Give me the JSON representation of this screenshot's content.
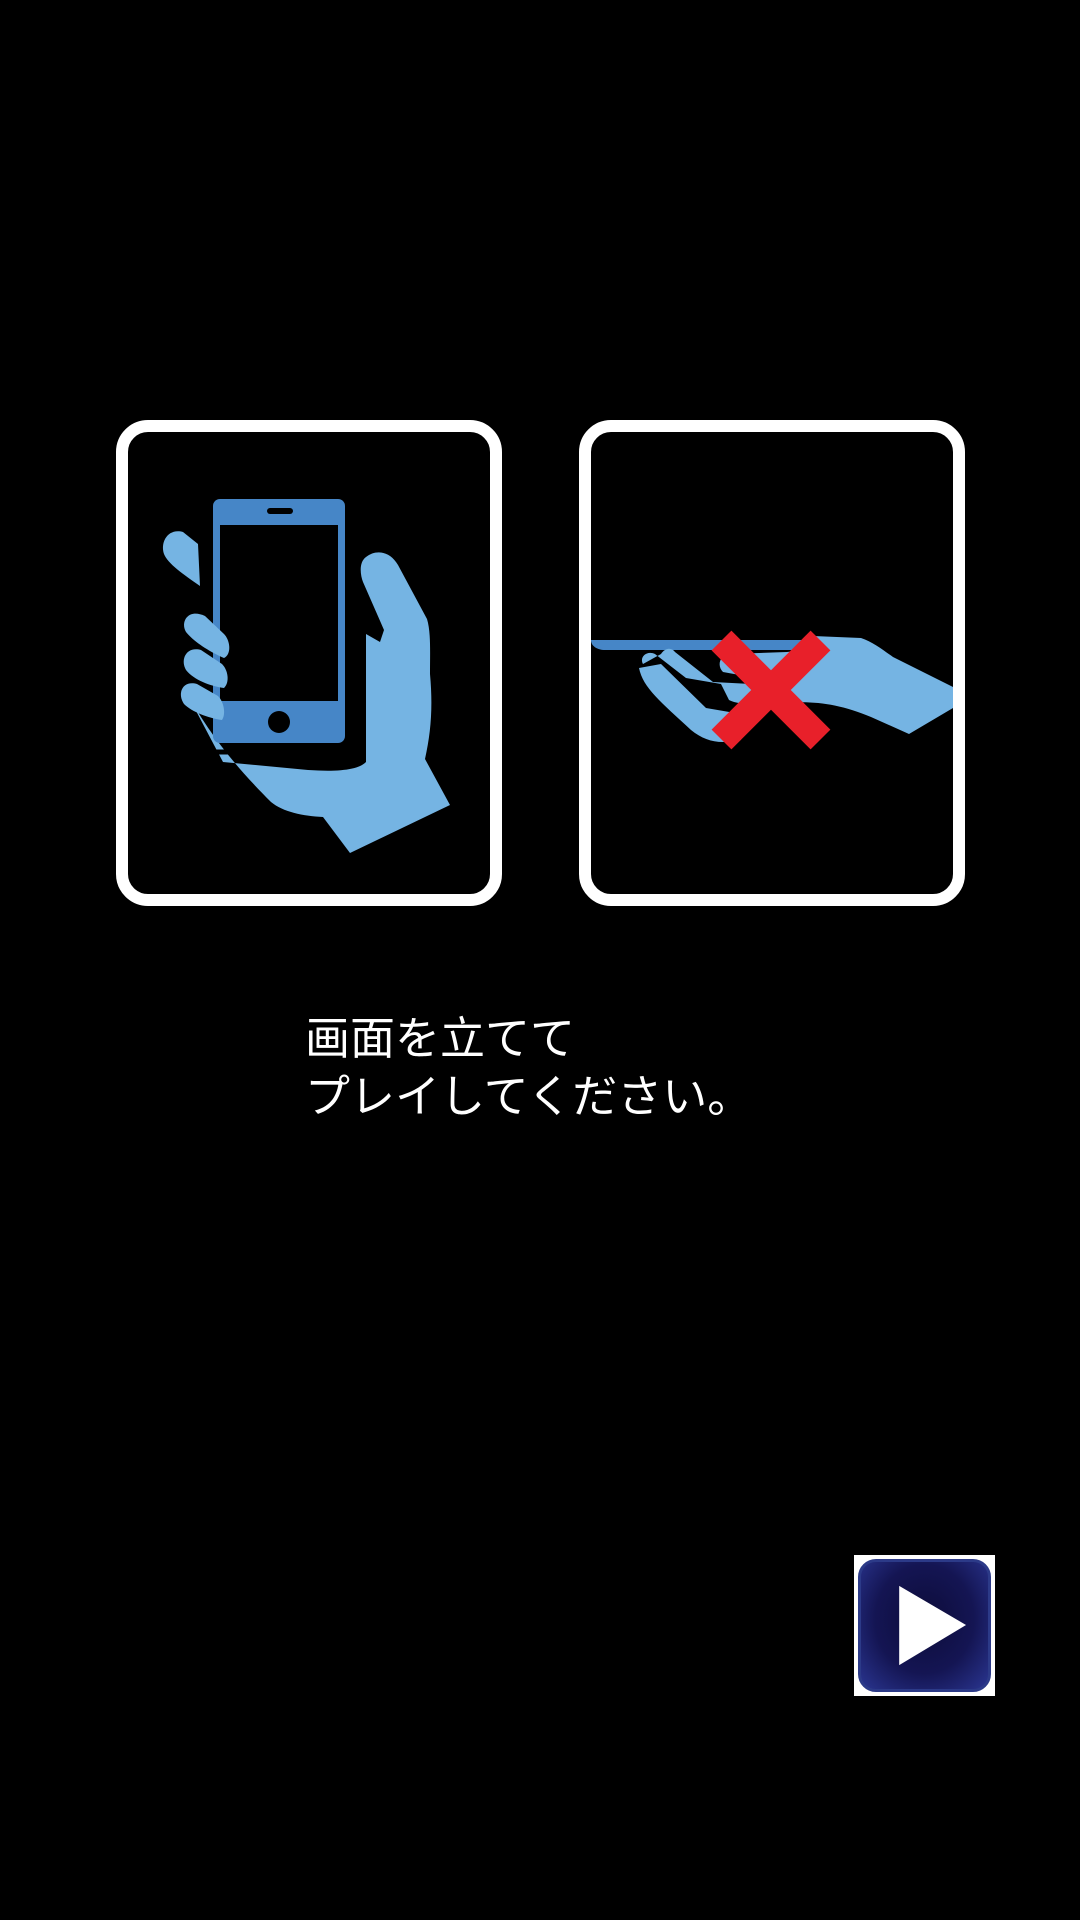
{
  "instruction": {
    "line1": "画面を立てて",
    "line2": "プレイしてください。"
  },
  "panels": {
    "correct": {
      "icon": "hand-holding-phone-upright-icon"
    },
    "incorrect": {
      "icon": "hand-holding-phone-flat-icon",
      "mark": "red-x-icon"
    }
  },
  "play_button": {
    "icon": "play-triangle-icon"
  },
  "colors": {
    "background": "#000000",
    "panel_border": "#ffffff",
    "hand": "#75b4e3",
    "phone": "#4686c7",
    "cross": "#e8202a",
    "button_bg": "#141553",
    "button_border": "#2c3a88"
  }
}
